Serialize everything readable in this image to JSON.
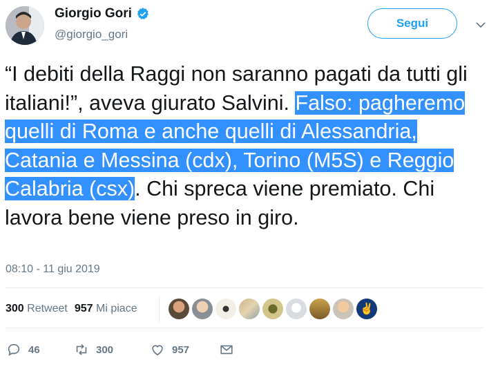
{
  "author": {
    "name": "Giorgio Gori",
    "handle": "@giorgio_gori",
    "verified": true
  },
  "follow_label": "Segui",
  "tweet": {
    "text_before": "“I debiti della Raggi non saranno pagati da tutti gli italiani!”, aveva giurato Salvini. ",
    "text_highlight": "Falso: pagheremo quelli di Roma e anche quelli di Alessandria, Catania e Messina (cdx), Torino (M5S) e Reggio Calabria (csx)",
    "text_after": ". Chi spreca viene premiato. Chi lavora bene viene preso in giro."
  },
  "timestamp": "08:10 - 11 giu 2019",
  "stats": {
    "retweets_count": "300",
    "retweets_label": "Retweet",
    "likes_count": "957",
    "likes_label": "Mi piace"
  },
  "liker_avatars_count": 9,
  "actions": {
    "replies": "46",
    "retweets": "300",
    "likes": "957"
  },
  "colors": {
    "accent": "#1da1f2",
    "highlight": "#3390ff",
    "muted": "#657786"
  }
}
